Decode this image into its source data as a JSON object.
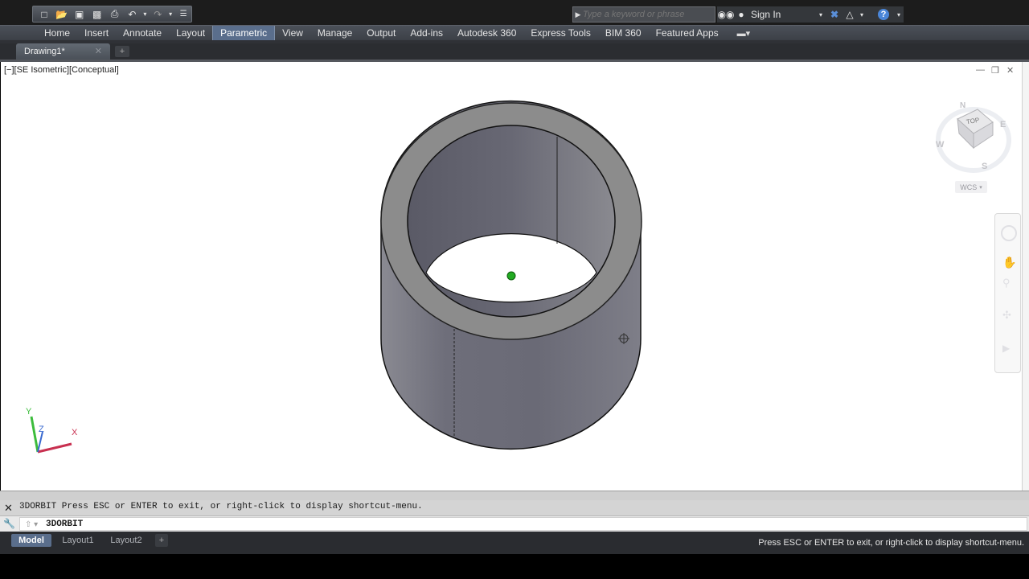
{
  "qat": {
    "icons": [
      "new-icon",
      "open-icon",
      "save-icon",
      "save-as-icon",
      "print-icon",
      "undo-icon",
      "dropdown-icon",
      "redo-icon",
      "dropdown-icon",
      "customize-icon"
    ]
  },
  "search": {
    "placeholder": "Type a keyword or phrase"
  },
  "account": {
    "sign_in": "Sign In"
  },
  "ribbon": {
    "tabs": [
      "Home",
      "Insert",
      "Annotate",
      "Layout",
      "Parametric",
      "View",
      "Manage",
      "Output",
      "Add-ins",
      "Autodesk 360",
      "Express Tools",
      "BIM 360",
      "Featured Apps"
    ],
    "active_tab": "Parametric"
  },
  "document": {
    "tab_title": "Drawing1*"
  },
  "viewport": {
    "label": "[−][SE Isometric][Conceptual]",
    "viewcube": {
      "top_label": "TOP",
      "front_label": "FRONT",
      "north": "N",
      "south": "S",
      "east": "E",
      "west": "W",
      "wcs": "WCS"
    },
    "ucs": {
      "x": "X",
      "y": "Y",
      "z": "Z"
    }
  },
  "command": {
    "output": "3DORBIT Press ESC or ENTER to exit, or right-click to display shortcut-menu.",
    "input": "3DORBIT"
  },
  "layouts": {
    "tabs": [
      "Model",
      "Layout1",
      "Layout2"
    ],
    "active": "Model"
  },
  "status_text": "Press ESC or ENTER to exit, or right-click to display shortcut-menu.",
  "colors": {
    "ribbon_active": "#5a6e8c",
    "cylinder_body": "#7a7a86",
    "cylinder_rim": "#8a8a8a",
    "orbit_center": "#22aa22"
  }
}
